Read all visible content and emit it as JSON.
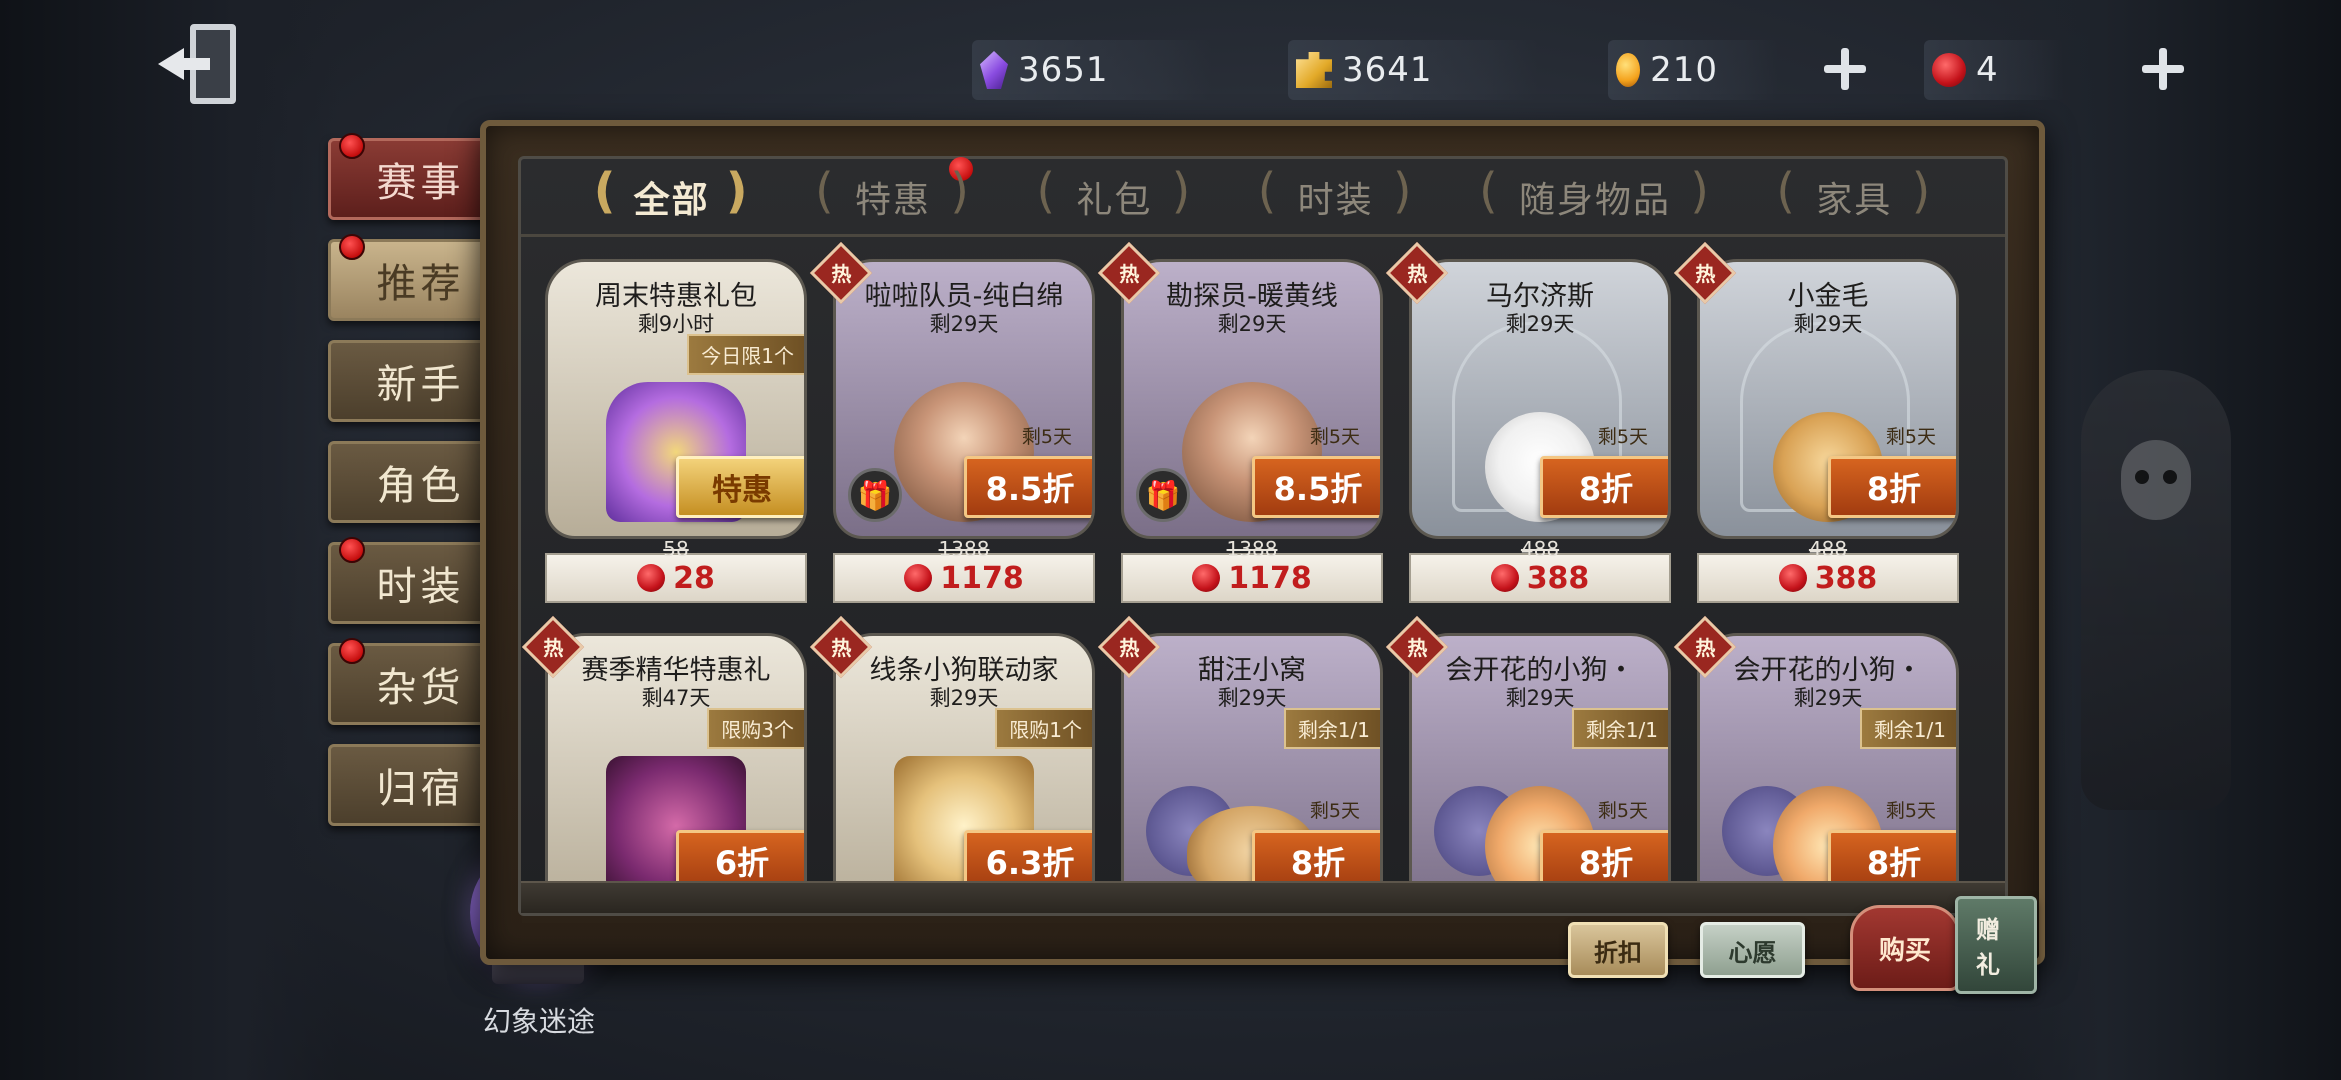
{
  "currencies": [
    {
      "name": "gem-icon",
      "value": "3651"
    },
    {
      "name": "puzzle-icon",
      "value": "3641"
    },
    {
      "name": "coin-icon",
      "value": "210"
    },
    {
      "name": "ticket-icon",
      "value": "4"
    }
  ],
  "nav": [
    {
      "label": "赛事",
      "dot": true,
      "state": "active"
    },
    {
      "label": "推荐",
      "dot": true,
      "state": "light"
    },
    {
      "label": "新手",
      "dot": false,
      "state": ""
    },
    {
      "label": "角色",
      "dot": false,
      "state": ""
    },
    {
      "label": "时装",
      "dot": true,
      "state": ""
    },
    {
      "label": "杂货",
      "dot": true,
      "state": ""
    },
    {
      "label": "归宿",
      "dot": false,
      "state": ""
    }
  ],
  "orb_label": "幻象迷途",
  "tabs": [
    {
      "label": "全部",
      "active": true,
      "dot": false
    },
    {
      "label": "特惠",
      "active": false,
      "dot": true
    },
    {
      "label": "礼包",
      "active": false,
      "dot": false
    },
    {
      "label": "时装",
      "active": false,
      "dot": false
    },
    {
      "label": "随身物品",
      "active": false,
      "dot": false
    },
    {
      "label": "家具",
      "active": false,
      "dot": false
    }
  ],
  "cards": [
    {
      "title": "周末特惠礼包",
      "sub": "剩9小时",
      "hot": false,
      "limit": "今日限1个",
      "small_tag": "",
      "discount": "特惠",
      "discount_style": "gold",
      "gift": false,
      "old_price": "58",
      "new_price": "28",
      "bg": "cream",
      "art": "crystal"
    },
    {
      "title": "啦啦队员-纯白绵",
      "sub": "剩29天",
      "hot": true,
      "hot_label": "热",
      "limit": "",
      "small_tag": "剩5天",
      "discount": "8.5折",
      "discount_style": "",
      "gift": true,
      "old_price": "1388",
      "new_price": "1178",
      "bg": "lilac",
      "art": "portrait"
    },
    {
      "title": "勘探员-暖黄线",
      "sub": "剩29天",
      "hot": true,
      "hot_label": "热",
      "limit": "",
      "small_tag": "剩5天",
      "discount": "8.5折",
      "discount_style": "",
      "gift": true,
      "old_price": "1388",
      "new_price": "1178",
      "bg": "lilac",
      "art": "portrait"
    },
    {
      "title": "马尔济斯",
      "sub": "剩29天",
      "hot": true,
      "hot_label": "热",
      "limit": "",
      "small_tag": "剩5天",
      "discount": "8折",
      "discount_style": "",
      "gift": false,
      "old_price": "488",
      "new_price": "388",
      "bg": "steel",
      "art": "dog-white"
    },
    {
      "title": "小金毛",
      "sub": "剩29天",
      "hot": true,
      "hot_label": "热",
      "limit": "",
      "small_tag": "剩5天",
      "discount": "8折",
      "discount_style": "",
      "gift": false,
      "old_price": "488",
      "new_price": "388",
      "bg": "steel",
      "art": "dog-gold"
    },
    {
      "title": "赛季精华特惠礼",
      "sub": "剩47天",
      "hot": true,
      "hot_label": "热",
      "limit": "限购3个",
      "small_tag": "",
      "discount": "6折",
      "discount_style": "",
      "gift": false,
      "old_price": "",
      "new_price": "",
      "bg": "cream",
      "art": "chest"
    },
    {
      "title": "线条小狗联动家",
      "sub": "剩29天",
      "hot": true,
      "hot_label": "热",
      "limit": "限购1个",
      "small_tag": "",
      "discount": "6.3折",
      "discount_style": "",
      "gift": false,
      "old_price": "",
      "new_price": "",
      "bg": "cream",
      "art": "box"
    },
    {
      "title": "甜汪小窝",
      "sub": "剩29天",
      "hot": true,
      "hot_label": "热",
      "limit": "剩余1/1",
      "small_tag": "剩5天",
      "discount": "8折",
      "discount_style": "",
      "gift": false,
      "old_price": "",
      "new_price": "",
      "bg": "lilac",
      "art": "bread"
    },
    {
      "title": "会开花的小狗・",
      "sub": "剩29天",
      "hot": true,
      "hot_label": "热",
      "limit": "剩余1/1",
      "small_tag": "剩5天",
      "discount": "8折",
      "discount_style": "",
      "gift": false,
      "old_price": "",
      "new_price": "",
      "bg": "lilac",
      "art": "flowers"
    },
    {
      "title": "会开花的小狗・",
      "sub": "剩29天",
      "hot": true,
      "hot_label": "热",
      "limit": "剩余1/1",
      "small_tag": "剩5天",
      "discount": "8折",
      "discount_style": "",
      "gift": false,
      "old_price": "",
      "new_price": "",
      "bg": "lilac",
      "art": "flowers"
    }
  ],
  "bottom_buttons": {
    "discount": "折扣",
    "wish": "心愿",
    "buy": "购买",
    "gift": "赠礼"
  }
}
